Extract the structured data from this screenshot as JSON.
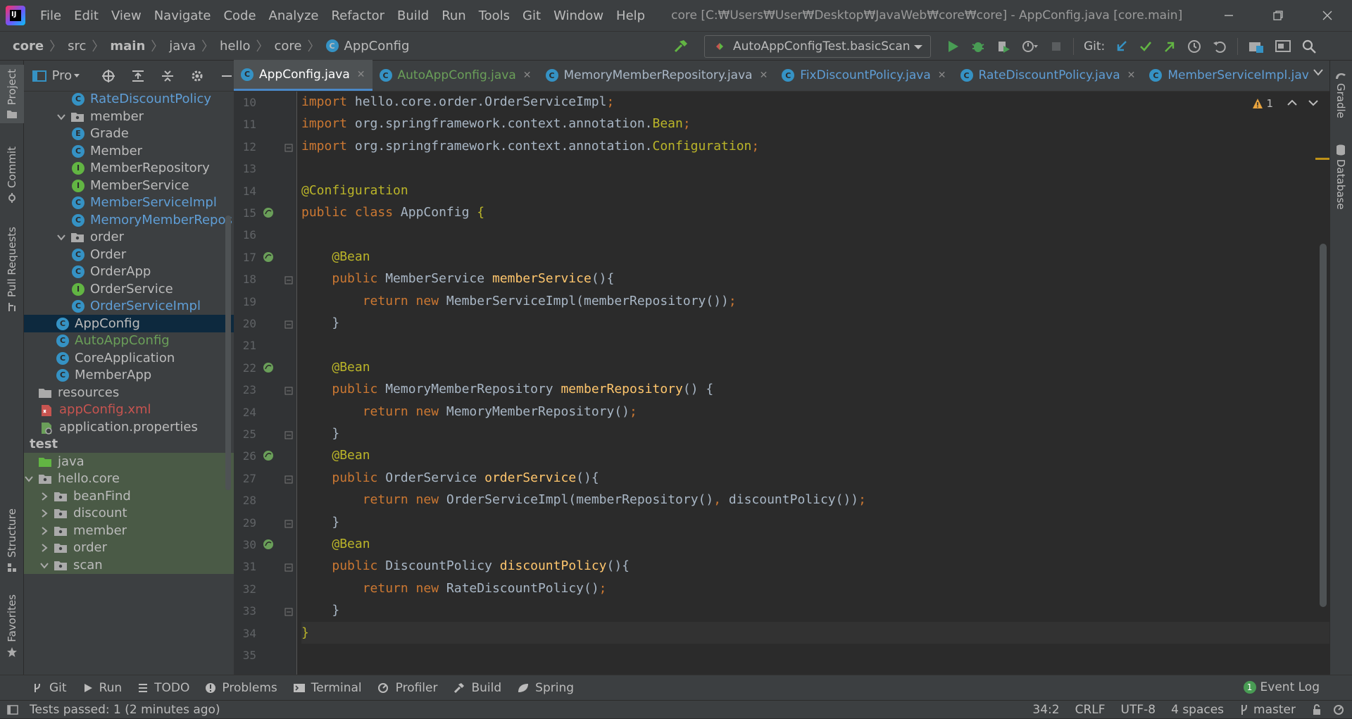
{
  "titlebar": {
    "menu": [
      "File",
      "Edit",
      "View",
      "Navigate",
      "Code",
      "Analyze",
      "Refactor",
      "Build",
      "Run",
      "Tools",
      "Git",
      "Window",
      "Help"
    ],
    "title": "core [C:₩Users₩User₩Desktop₩JavaWeb₩core₩core] - AppConfig.java [core.main]"
  },
  "navbar": {
    "breadcrumbs": [
      "core",
      "src",
      "main",
      "java",
      "hello",
      "core",
      "AppConfig"
    ],
    "run_config": "AutoAppConfigTest.basicScan",
    "git_label": "Git:"
  },
  "left_tool_tabs": [
    "Project",
    "Commit",
    "Pull Requests",
    "Structure",
    "Favorites"
  ],
  "right_tool_tabs": [
    "Gradle",
    "Database"
  ],
  "project_panel": {
    "title": "Pro",
    "tree": [
      {
        "label": "RateDiscountPolicy",
        "kind": "class",
        "depth": 3,
        "color": "#5f9ed6"
      },
      {
        "label": "member",
        "kind": "package",
        "depth": 2,
        "expanded": true
      },
      {
        "label": "Grade",
        "kind": "enum",
        "depth": 3
      },
      {
        "label": "Member",
        "kind": "class",
        "depth": 3
      },
      {
        "label": "MemberRepository",
        "kind": "interface",
        "depth": 3
      },
      {
        "label": "MemberService",
        "kind": "interface",
        "depth": 3
      },
      {
        "label": "MemberServiceImpl",
        "kind": "class",
        "depth": 3,
        "color": "#5f9ed6"
      },
      {
        "label": "MemoryMemberRepos",
        "kind": "class",
        "depth": 3,
        "color": "#5f9ed6"
      },
      {
        "label": "order",
        "kind": "package",
        "depth": 2,
        "expanded": true
      },
      {
        "label": "Order",
        "kind": "class",
        "depth": 3
      },
      {
        "label": "OrderApp",
        "kind": "class",
        "depth": 3
      },
      {
        "label": "OrderService",
        "kind": "interface",
        "depth": 3
      },
      {
        "label": "OrderServiceImpl",
        "kind": "class",
        "depth": 3,
        "color": "#5f9ed6"
      },
      {
        "label": "AppConfig",
        "kind": "class",
        "depth": 2,
        "selected": true
      },
      {
        "label": "AutoAppConfig",
        "kind": "class",
        "depth": 2,
        "color": "#6a9f59"
      },
      {
        "label": "CoreApplication",
        "kind": "class",
        "depth": 2
      },
      {
        "label": "MemberApp",
        "kind": "class",
        "depth": 2
      },
      {
        "label": "resources",
        "kind": "folder",
        "depth": 0
      },
      {
        "label": "appConfig.xml",
        "kind": "xml",
        "depth": 1,
        "color": "#c75450"
      },
      {
        "label": "application.properties",
        "kind": "props",
        "depth": 1
      },
      {
        "label": "test",
        "kind": "header",
        "depth": 0
      },
      {
        "label": "java",
        "kind": "testfolder",
        "depth": 0,
        "green": true
      },
      {
        "label": "hello.core",
        "kind": "package",
        "depth": 0,
        "expanded": true,
        "green": true
      },
      {
        "label": "beanFind",
        "kind": "package",
        "depth": 1,
        "collapsed": true,
        "green": true
      },
      {
        "label": "discount",
        "kind": "package",
        "depth": 1,
        "collapsed": true,
        "green": true
      },
      {
        "label": "member",
        "kind": "package",
        "depth": 1,
        "collapsed": true,
        "green": true
      },
      {
        "label": "order",
        "kind": "package",
        "depth": 1,
        "collapsed": true,
        "green": true
      },
      {
        "label": "scan",
        "kind": "package",
        "depth": 1,
        "expanded": true,
        "green": true
      }
    ]
  },
  "editor_tabs": [
    {
      "label": "AppConfig.java",
      "active": true
    },
    {
      "label": "AutoAppConfig.java",
      "color": "#6a9f59"
    },
    {
      "label": "MemoryMemberRepository.java",
      "color": "#a9b7c6"
    },
    {
      "label": "FixDiscountPolicy.java",
      "color": "#5f9ed6"
    },
    {
      "label": "RateDiscountPolicy.java",
      "color": "#5f9ed6"
    },
    {
      "label": "MemberServiceImpl.jav",
      "color": "#5f9ed6"
    }
  ],
  "editor": {
    "warnings": "1",
    "current_line": 34,
    "lines": [
      {
        "n": "10",
        "t": [
          [
            "kw",
            "import "
          ],
          [
            "",
            "hello.core.order.OrderServiceImpl"
          ],
          [
            "kw",
            ";"
          ]
        ]
      },
      {
        "n": "11",
        "t": [
          [
            "kw",
            "import "
          ],
          [
            "",
            "org.springframework.context.annotation."
          ],
          [
            "an",
            "Bean"
          ],
          [
            "kw",
            ";"
          ]
        ]
      },
      {
        "n": "12",
        "t": [
          [
            "kw",
            "import "
          ],
          [
            "",
            "org.springframework.context.annotation."
          ],
          [
            "an",
            "Configuration"
          ],
          [
            "kw",
            ";"
          ]
        ]
      },
      {
        "n": "13",
        "t": []
      },
      {
        "n": "14",
        "t": [
          [
            "an",
            "@Configuration"
          ]
        ]
      },
      {
        "n": "15",
        "t": [
          [
            "kw",
            "public class "
          ],
          [
            "",
            "AppConfig "
          ],
          [
            "an",
            "{"
          ]
        ]
      },
      {
        "n": "16",
        "t": []
      },
      {
        "n": "17",
        "t": [
          [
            "",
            "    "
          ],
          [
            "an",
            "@Bean"
          ]
        ]
      },
      {
        "n": "18",
        "t": [
          [
            "",
            "    "
          ],
          [
            "kw",
            "public "
          ],
          [
            "",
            "MemberService "
          ],
          [
            "fn",
            "memberService"
          ],
          [
            "",
            "(){"
          ]
        ]
      },
      {
        "n": "19",
        "t": [
          [
            "",
            "        "
          ],
          [
            "kw",
            "return new "
          ],
          [
            "",
            "MemberServiceImpl(memberRepository())"
          ],
          [
            "kw",
            ";"
          ]
        ]
      },
      {
        "n": "20",
        "t": [
          [
            "",
            "    }"
          ]
        ]
      },
      {
        "n": "21",
        "t": []
      },
      {
        "n": "22",
        "t": [
          [
            "",
            "    "
          ],
          [
            "an",
            "@Bean"
          ]
        ]
      },
      {
        "n": "23",
        "t": [
          [
            "",
            "    "
          ],
          [
            "kw",
            "public "
          ],
          [
            "",
            "MemoryMemberRepository "
          ],
          [
            "fn",
            "memberRepository"
          ],
          [
            "",
            "() {"
          ]
        ]
      },
      {
        "n": "24",
        "t": [
          [
            "",
            "        "
          ],
          [
            "kw",
            "return new "
          ],
          [
            "",
            "MemoryMemberRepository()"
          ],
          [
            "kw",
            ";"
          ]
        ]
      },
      {
        "n": "25",
        "t": [
          [
            "",
            "    }"
          ]
        ]
      },
      {
        "n": "26",
        "t": [
          [
            "",
            "    "
          ],
          [
            "an",
            "@Bean"
          ]
        ]
      },
      {
        "n": "27",
        "t": [
          [
            "",
            "    "
          ],
          [
            "kw",
            "public "
          ],
          [
            "",
            "OrderService "
          ],
          [
            "fn",
            "orderService"
          ],
          [
            "",
            "(){"
          ]
        ]
      },
      {
        "n": "28",
        "t": [
          [
            "",
            "        "
          ],
          [
            "kw",
            "return new "
          ],
          [
            "",
            "OrderServiceImpl(memberRepository()"
          ],
          [
            "kw",
            ", "
          ],
          [
            "",
            "discountPolicy())"
          ],
          [
            "kw",
            ";"
          ]
        ]
      },
      {
        "n": "29",
        "t": [
          [
            "",
            "    }"
          ]
        ]
      },
      {
        "n": "30",
        "t": [
          [
            "",
            "    "
          ],
          [
            "an",
            "@Bean"
          ]
        ]
      },
      {
        "n": "31",
        "t": [
          [
            "",
            "    "
          ],
          [
            "kw",
            "public "
          ],
          [
            "",
            "DiscountPolicy "
          ],
          [
            "fn",
            "discountPolicy"
          ],
          [
            "",
            "(){"
          ]
        ]
      },
      {
        "n": "32",
        "t": [
          [
            "",
            "        "
          ],
          [
            "kw",
            "return new "
          ],
          [
            "",
            "RateDiscountPolicy()"
          ],
          [
            "kw",
            ";"
          ]
        ]
      },
      {
        "n": "33",
        "t": [
          [
            "",
            "    }"
          ]
        ]
      },
      {
        "n": "34",
        "t": [
          [
            "an",
            "}"
          ]
        ]
      },
      {
        "n": "35",
        "t": []
      }
    ]
  },
  "bottom_tools": [
    {
      "label": "Git",
      "icon": "git-icon"
    },
    {
      "label": "Run",
      "icon": "run-icon"
    },
    {
      "label": "TODO",
      "icon": "todo-icon"
    },
    {
      "label": "Problems",
      "icon": "problems-icon"
    },
    {
      "label": "Terminal",
      "icon": "terminal-icon"
    },
    {
      "label": "Profiler",
      "icon": "profiler-icon"
    },
    {
      "label": "Build",
      "icon": "build-icon"
    },
    {
      "label": "Spring",
      "icon": "spring-icon"
    }
  ],
  "event_log": {
    "count": "1",
    "label": "Event Log"
  },
  "statusbar": {
    "message": "Tests passed: 1 (2 minutes ago)",
    "position": "34:2",
    "line_sep": "CRLF",
    "encoding": "UTF-8",
    "indent": "4 spaces",
    "branch": "master"
  },
  "colors": {
    "keyword": "#cc7832",
    "annotation": "#bbb529",
    "method": "#ffc66d",
    "text": "#a9b7c6",
    "accent": "#4a88c7"
  }
}
